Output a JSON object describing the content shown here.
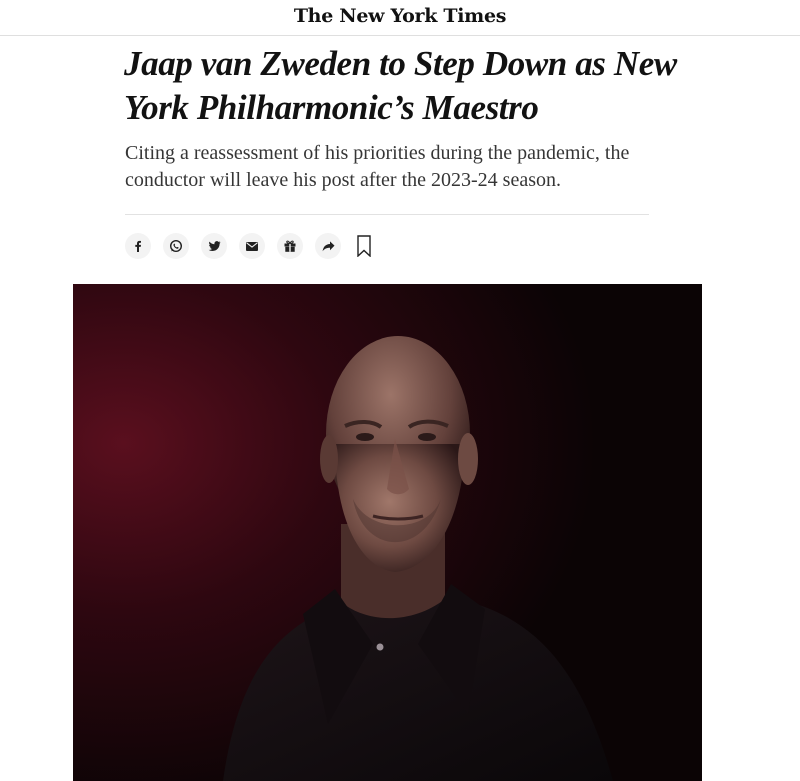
{
  "masthead": {
    "logo_text": "The New York Times"
  },
  "article": {
    "headline": "Jaap van Zweden to Step Down as New York Philharmonic’s Maestro",
    "summary": "Citing a reassessment of his priorities during the pandemic, the conductor will leave his post after the 2023-24 season."
  },
  "share_bar": {
    "buttons": [
      {
        "icon": "facebook-icon"
      },
      {
        "icon": "whatsapp-icon"
      },
      {
        "icon": "twitter-icon"
      },
      {
        "icon": "email-icon"
      },
      {
        "icon": "gift-icon"
      },
      {
        "icon": "share-arrow-icon"
      }
    ],
    "bookmark_icon": "bookmark-icon"
  },
  "hero_image": {
    "subject": "portrait-photo",
    "colors": {
      "background_dark": "#0b0405",
      "background_red": "#5a0f1e",
      "shirt": "#120d10"
    }
  },
  "colors": {
    "text": "#121212",
    "summary_text": "#363636",
    "divider": "#e2e2e2",
    "share_button_bg": "#f3f3f3"
  }
}
